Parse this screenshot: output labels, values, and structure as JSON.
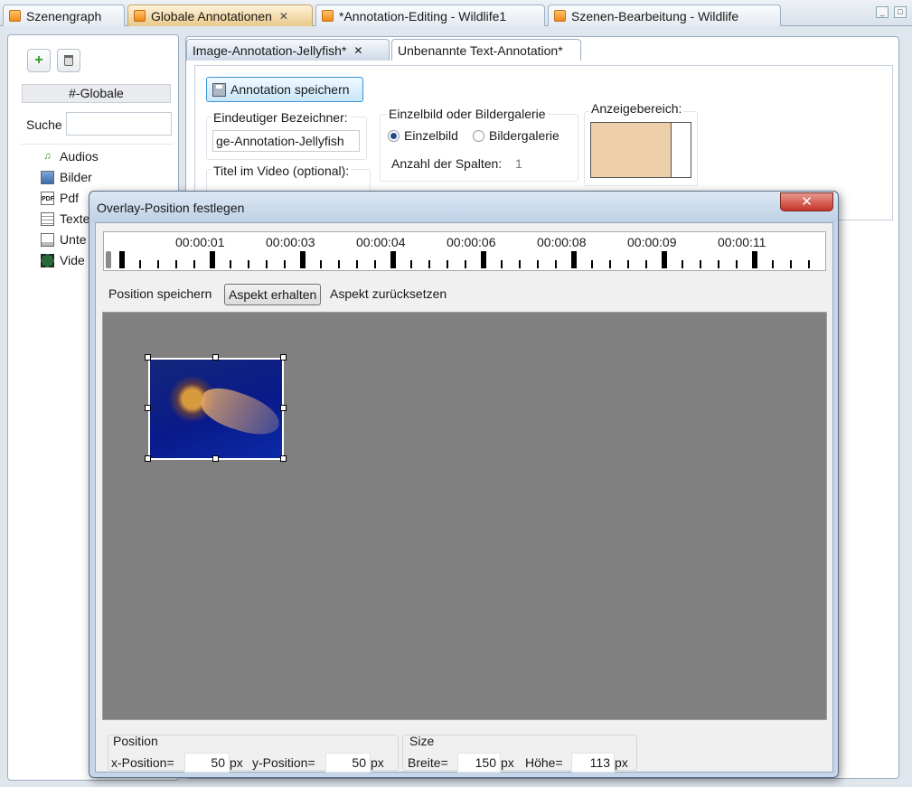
{
  "top_tabs": [
    {
      "label": "Szenengraph",
      "closable": false,
      "active": false
    },
    {
      "label": "Globale Annotationen",
      "closable": true,
      "active": true
    },
    {
      "label": "*Annotation-Editing - Wildlife1",
      "closable": false,
      "active": false
    },
    {
      "label": "Szenen-Bearbeitung -   Wildlife",
      "closable": false,
      "active": false
    }
  ],
  "window_buttons": {
    "minimize": "_",
    "maximize": "□"
  },
  "left_panel": {
    "add_icon": "plus-icon",
    "delete_icon": "trash-icon",
    "header": "#-Globale",
    "search_label": "Suche",
    "search_value": "",
    "tree_items": [
      {
        "label": "Audios",
        "icon": "audio-icon"
      },
      {
        "label": "Bilder",
        "icon": "image-icon"
      },
      {
        "label": "Pdf",
        "icon": "pdf-icon"
      },
      {
        "label": "Texte",
        "icon": "text-icon"
      },
      {
        "label": "Unte",
        "icon": "subtitle-icon"
      },
      {
        "label": "Vide",
        "icon": "video-icon"
      }
    ]
  },
  "editor": {
    "tabs": [
      {
        "label": "Image-Annotation-Jellyfish*",
        "closable": true,
        "active": true
      },
      {
        "label": "Unbenannte Text-Annotation*",
        "closable": false,
        "active": false
      }
    ],
    "save_button": "Annotation speichern",
    "identifier_label": "Eindeutiger Bezeichner:",
    "identifier_value": "ge-Annotation-Jellyfish",
    "title_label": "Titel im Video (optional):",
    "gallery_group_label": "Einzelbild oder Bildergalerie",
    "radio_single": "Einzelbild",
    "radio_gallery": "Bildergalerie",
    "radio_selected": "Einzelbild",
    "columns_label": "Anzahl der Spalten:",
    "columns_value": "1",
    "display_area_label": "Anzeigebereich:"
  },
  "dialog": {
    "title": "Overlay-Position festlegen",
    "close_symbol": "✕",
    "timeline_labels": [
      "00:00:01",
      "00:00:03",
      "00:00:04",
      "00:00:06",
      "00:00:08",
      "00:00:09",
      "00:00:11"
    ],
    "buttons": {
      "save_position": "Position speichern",
      "keep_aspect": "Aspekt erhalten",
      "reset_aspect": "Aspekt zurücksetzen"
    },
    "overlay_image": "jellyfish-image",
    "position": {
      "group_label": "Position",
      "x_label": "x-Position=",
      "x_value": "50",
      "y_label": "y-Position=",
      "y_value": "50",
      "unit": "px"
    },
    "size": {
      "group_label": "Size",
      "width_label": "Breite=",
      "width_value": "150",
      "height_label": "Höhe=",
      "height_value": "113",
      "unit": "px"
    }
  },
  "colors": {
    "canvas_bg": "#808080",
    "display_area_fill": "#edcfaa",
    "close_button": "#c5352a",
    "active_tab": "#e9c98a"
  }
}
